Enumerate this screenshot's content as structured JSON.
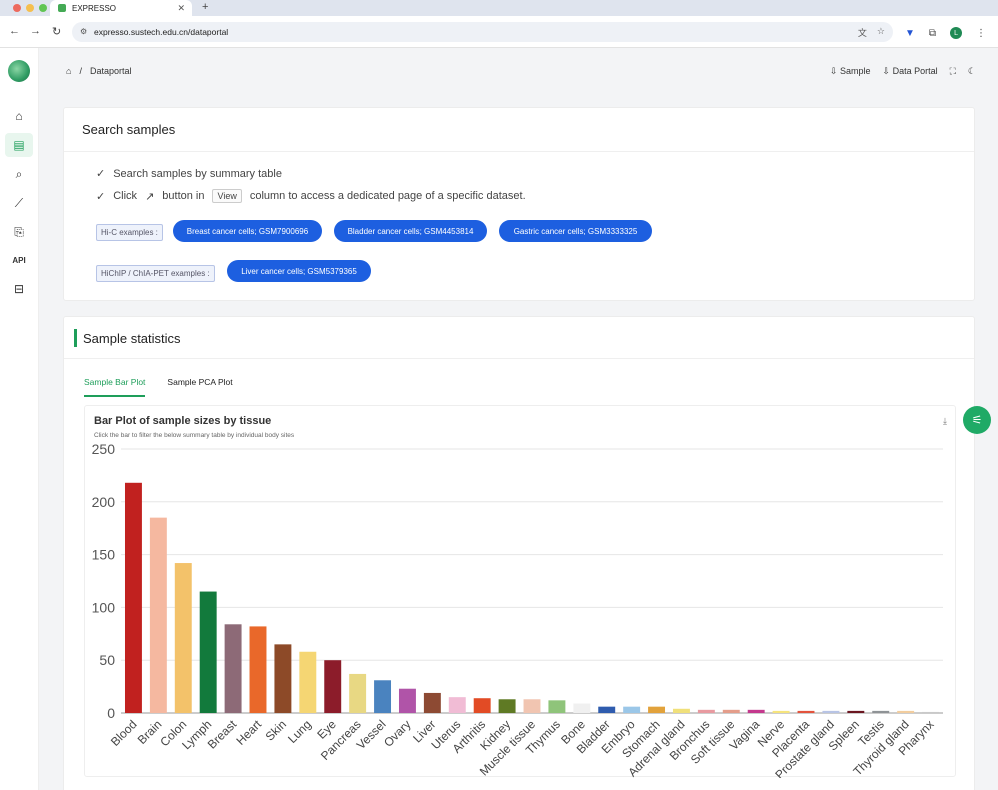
{
  "browser": {
    "tab_title": "EXPRESSO",
    "url": "expresso.sustech.edu.cn/dataportal",
    "avatar_letter": "L"
  },
  "breadcrumb": {
    "home_icon": "home-icon",
    "separator": "/",
    "current": "Dataportal"
  },
  "header": {
    "sample_label": "Sample",
    "data_portal_label": "Data Portal"
  },
  "search_card": {
    "title": "Search samples",
    "tip1": "Search samples by summary table",
    "tip2_before": "Click",
    "tip2_middle": "button in",
    "tip2_key": "View",
    "tip2_after": "column to access a dedicated page of a specific dataset.",
    "hic_label": "Hi-C examples :",
    "hic_examples": [
      "Breast cancer cells; GSM7900696",
      "Bladder cancer cells; GSM4453814",
      "Gastric cancer cells; GSM3333325"
    ],
    "hichip_label": "HiChIP / ChIA-PET examples :",
    "hichip_examples": [
      "Liver cancer cells; GSM5379365"
    ]
  },
  "stats_card": {
    "title": "Sample statistics",
    "tabs": [
      "Sample Bar Plot",
      "Sample PCA Plot"
    ],
    "chart_title": "Bar Plot of sample sizes by tissue",
    "chart_subtitle": "Click the bar to filter the below summary table by individual body sites"
  },
  "chart_data": {
    "type": "bar",
    "title": "Bar Plot of sample sizes by tissue",
    "ylim": [
      0,
      250
    ],
    "yticks": [
      0,
      50,
      100,
      150,
      200,
      250
    ],
    "grid": true,
    "categories": [
      "Blood",
      "Brain",
      "Colon",
      "Lymph",
      "Breast",
      "Heart",
      "Skin",
      "Lung",
      "Eye",
      "Pancreas",
      "Vessel",
      "Ovary",
      "Liver",
      "Uterus",
      "Arthritis",
      "Kidney",
      "Muscle tissue",
      "Thymus",
      "Bone",
      "Bladder",
      "Embryo",
      "Stomach",
      "Adrenal gland",
      "Bronchus",
      "Soft tissue",
      "Vagina",
      "Nerve",
      "Placenta",
      "Prostate gland",
      "Spleen",
      "Testis",
      "Thyroid gland",
      "Pharynx"
    ],
    "values": [
      218,
      185,
      142,
      115,
      84,
      82,
      65,
      58,
      50,
      37,
      31,
      23,
      19,
      15,
      14,
      13,
      13,
      12,
      9,
      6,
      6,
      6,
      4,
      3,
      3,
      3,
      2,
      2,
      2,
      2,
      2,
      2,
      1
    ],
    "colors": [
      "#c1211f",
      "#f5b8a0",
      "#f3c26a",
      "#127a3c",
      "#8d6a77",
      "#e9682a",
      "#8d4a28",
      "#f5d673",
      "#8c1c2a",
      "#e8d883",
      "#4a83bf",
      "#b054a8",
      "#8d4a33",
      "#f1bcd5",
      "#e24b25",
      "#5f7a24",
      "#f1c5b1",
      "#8fc47a",
      "#f0f0f0",
      "#2f5cae",
      "#9bc7e8",
      "#e2a23b",
      "#f0e07a",
      "#e89aa0",
      "#e49d8a",
      "#c4388d",
      "#f6e47c",
      "#e3533c",
      "#b8c4e5",
      "#6b1620",
      "#8f9396",
      "#f2cd9e",
      "#c9c9c9"
    ]
  }
}
